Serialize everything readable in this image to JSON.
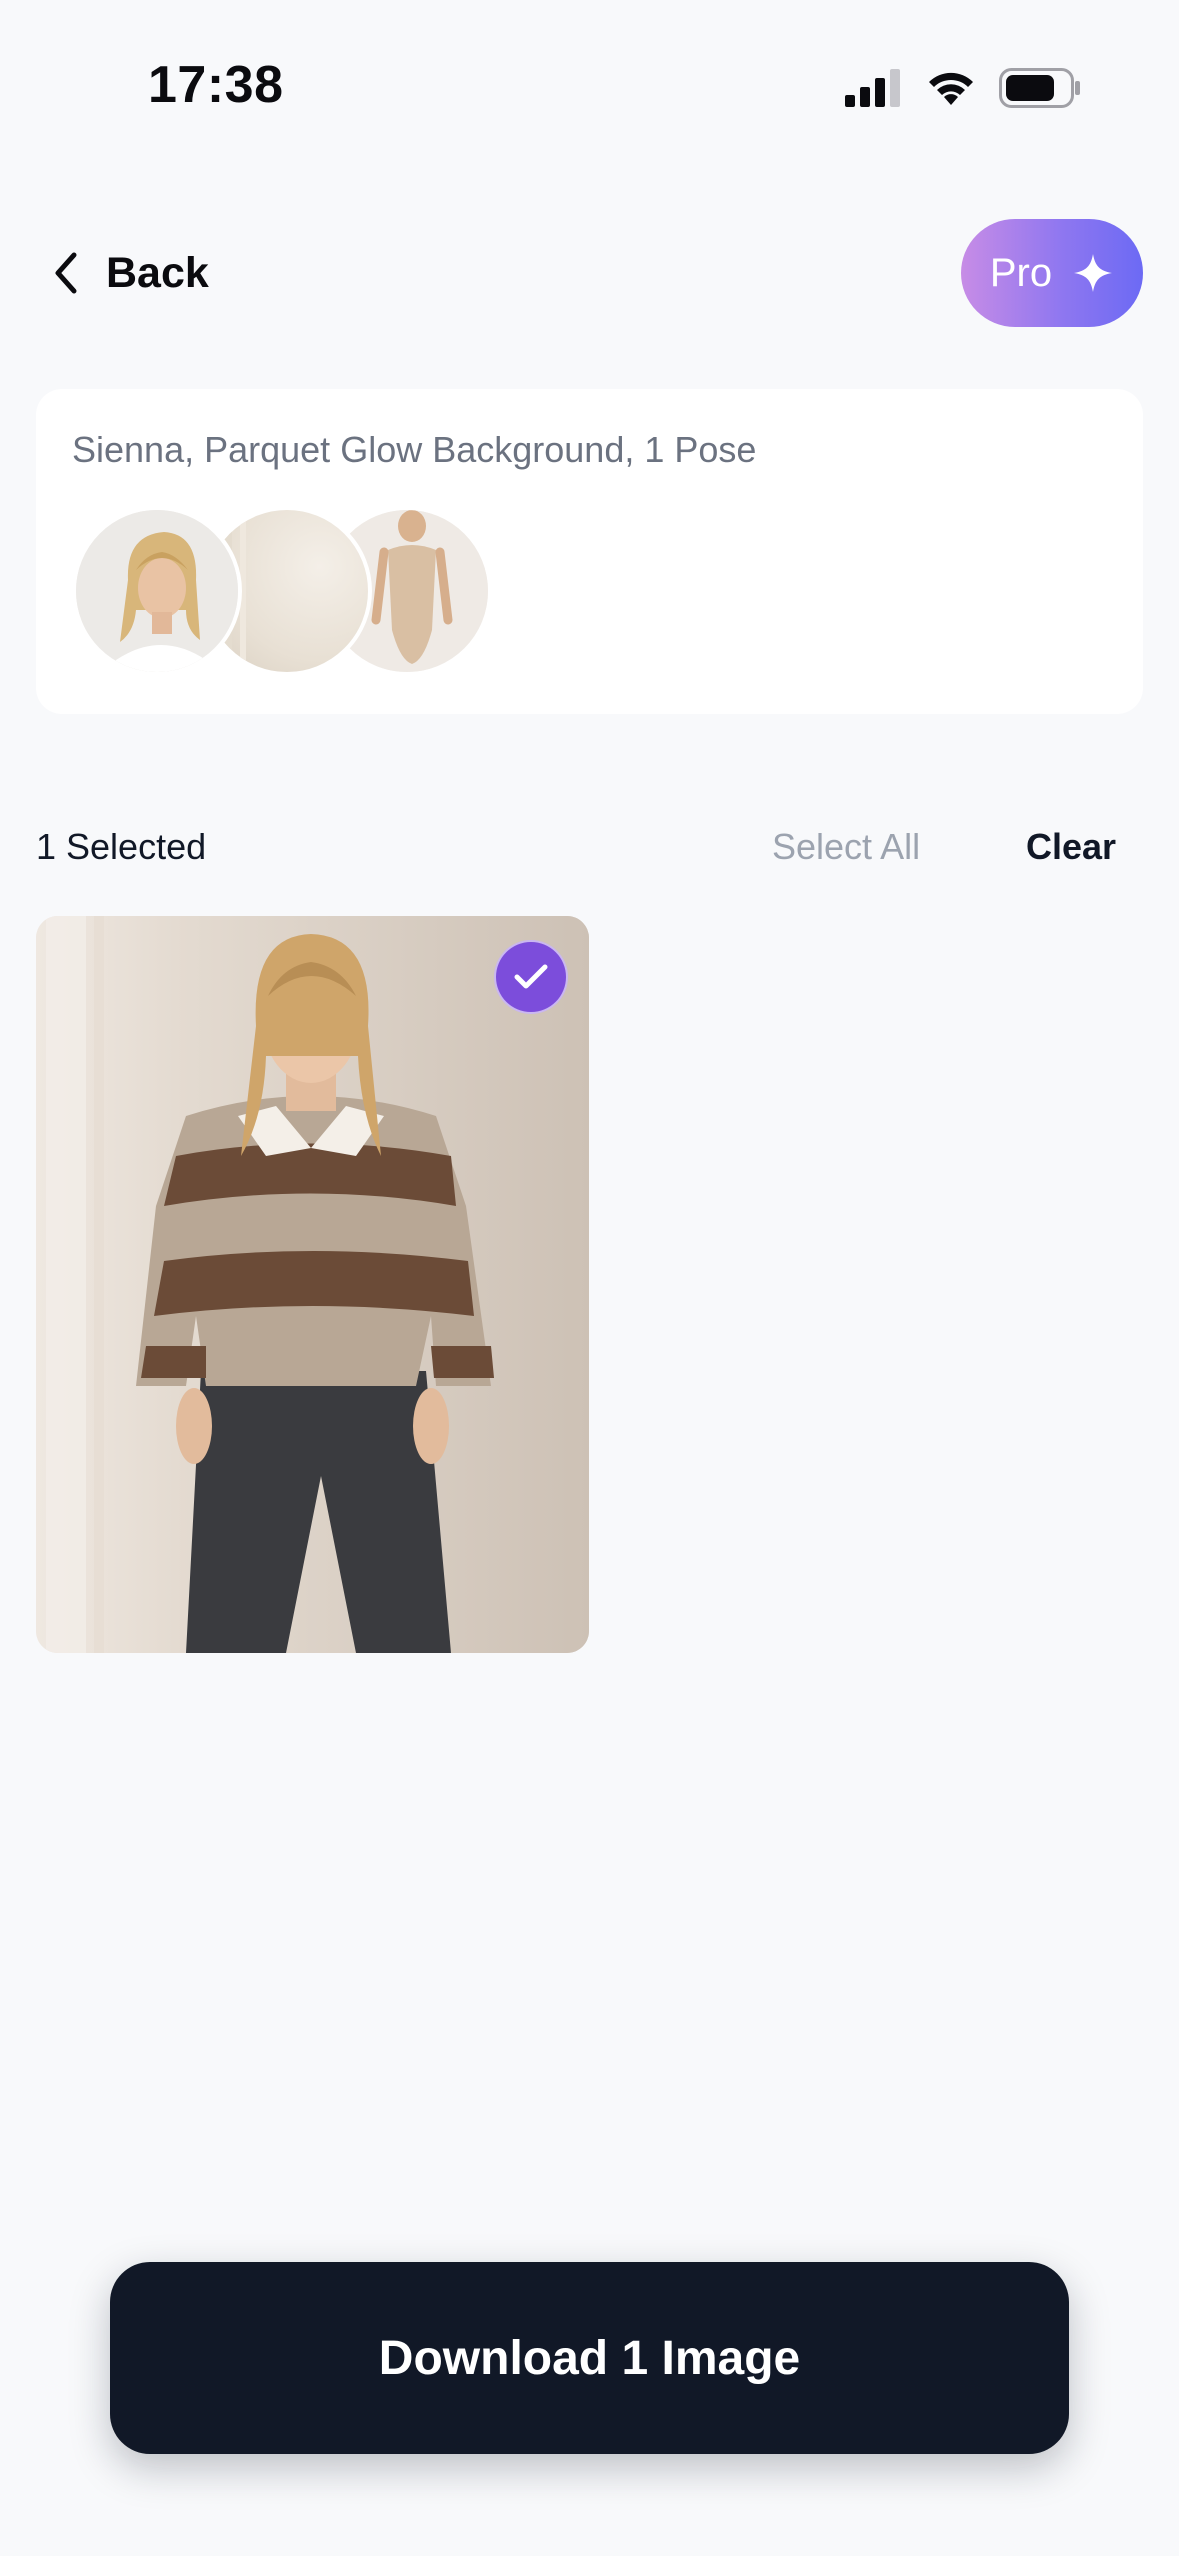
{
  "status_bar": {
    "time": "17:38",
    "icons": [
      "cellular-signal-icon",
      "wifi-icon",
      "battery-icon"
    ]
  },
  "header": {
    "back_label": "Back",
    "pro_label": "Pro",
    "pro_icon": "sparkle-icon"
  },
  "summary": {
    "text": "Sienna, Parquet Glow Background, 1 Pose",
    "thumbnails": [
      "model-thumbnail",
      "background-thumbnail",
      "pose-thumbnail"
    ]
  },
  "selection": {
    "count_label": "1 Selected",
    "select_all_label": "Select All",
    "clear_label": "Clear"
  },
  "gallery": {
    "images": [
      {
        "selected": true
      }
    ]
  },
  "footer": {
    "download_label": "Download 1 Image"
  },
  "colors": {
    "background": "#f8f9fb",
    "primary_dark": "#111827",
    "accent_purple": "#7c4ddb",
    "pro_gradient_start": "#c78ce6",
    "pro_gradient_end": "#6c6af4",
    "muted_text": "#9ca3af"
  }
}
